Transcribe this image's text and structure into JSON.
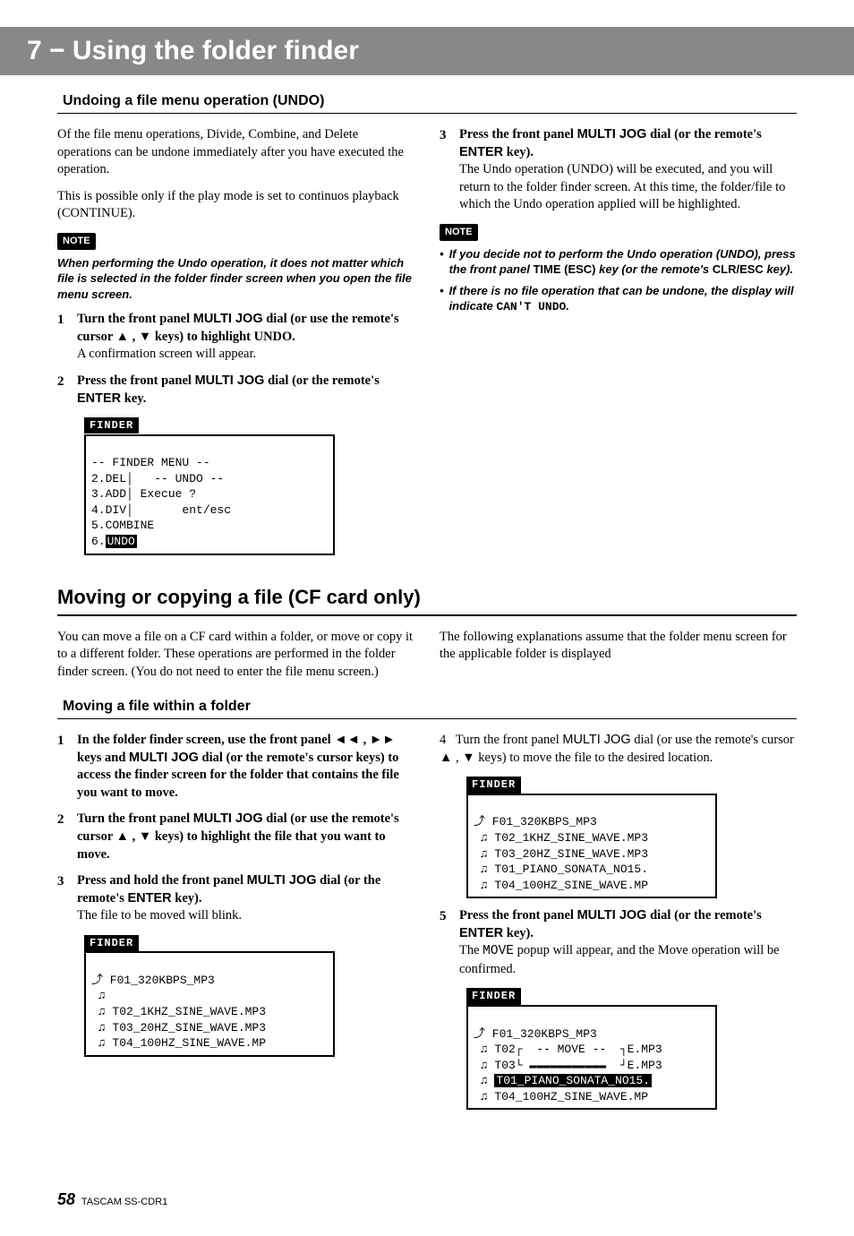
{
  "header": {
    "title": "7 − Using the folder finder"
  },
  "undo_section": {
    "heading": "Undoing a file menu operation (UNDO)",
    "intro1": "Of the file menu operations, Divide, Combine, and Delete operations can be undone immediately after you have executed the operation.",
    "intro2": "This is possible only if the play mode is set to continuos playback (CONTINUE).",
    "note_badge": "NOTE",
    "note_text": "When performing the Undo operation, it does not matter which file is selected in the folder finder screen when you open the file menu screen.",
    "step1_num": "1",
    "step1_bold_a": "Turn the front panel ",
    "step1_multi": "MULTI JOG",
    "step1_bold_b": " dial (or use the remote's cursor ▲ , ▼ keys) to highlight UNDO.",
    "step1_plain": "A confirmation screen will appear.",
    "step2_num": "2",
    "step2_bold_a": "Press the front panel ",
    "step2_multi": "MULTI JOG",
    "step2_bold_b": " dial (or the remote's ",
    "step2_enter": "ENTER",
    "step2_bold_c": " key.",
    "step3_num": "3",
    "step3_bold_a": "Press the front panel ",
    "step3_multi": "MULTI JOG",
    "step3_bold_b": " dial (or the remote's ",
    "step3_enter": "ENTER",
    "step3_bold_c": " key).",
    "step3_plain": "The Undo operation (UNDO) will be executed, and you will return to the folder finder screen. At this time, the folder/file to which the Undo operation applied will be highlighted.",
    "note2_badge": "NOTE",
    "bullet1_a": "If you decide not to perform the Undo operation (UNDO), press the front panel ",
    "bullet1_time": "TIME (ESC)",
    "bullet1_b": " key (or the remote's ",
    "bullet1_clr": "CLR/ESC",
    "bullet1_c": " key).",
    "bullet2_a": "If there is no file operation that can be undone, the display will indicate ",
    "bullet2_mono": "CAN'T UNDO",
    "bullet2_b": ".",
    "lcd1_title": "FINDER",
    "lcd1_line1": "-- FINDER MENU --",
    "lcd1_line2": "2.DEL│   -- UNDO --",
    "lcd1_line3": "3.ADD│ Execue ?",
    "lcd1_line4": "4.DIV│       ent/esc",
    "lcd1_line5": "5.COMBINE",
    "lcd1_line6a": "6.",
    "lcd1_line6b": "UNDO"
  },
  "move_section": {
    "heading": "Moving or copying a file (CF card only)",
    "intro_left": "You can move a file on a CF card within a folder, or move or copy it to a different folder. These operations are performed in the folder finder screen. (You do not need to enter the file menu screen.)",
    "intro_right": "The following explanations assume that the folder menu screen for the applicable folder is displayed",
    "sub_heading": "Moving a file within a folder",
    "step1_num": "1",
    "step1_bold_a": "In the folder finder screen, use the front panel ◄◄ , ►► keys and ",
    "step1_multi": "MULTI JOG",
    "step1_bold_b": " dial (or the remote's cursor keys) to access the finder screen for the folder that contains the file you want to move.",
    "step2_num": "2",
    "step2_bold_a": "Turn the front panel ",
    "step2_multi": "MULTI JOG",
    "step2_bold_b": " dial (or use the remote's cursor ▲ , ▼ keys) to highlight the file that you want to move.",
    "step3_num": "3",
    "step3_bold_a": "Press and hold the front panel ",
    "step3_multi": "MULTI JOG",
    "step3_bold_b": " dial (or the remote's ",
    "step3_enter": "ENTER",
    "step3_bold_c": " key).",
    "step3_plain": "The file to be moved will blink.",
    "step4_num": "4",
    "step4_bold_a": "Turn the front panel ",
    "step4_multi": "MULTI JOG",
    "step4_bold_b": " dial (or use the remote's cursor ▲ , ▼ keys) to move the file to the desired location.",
    "step5_num": "5",
    "step5_bold_a": "Press the front panel ",
    "step5_multi": "MULTI JOG",
    "step5_bold_b": " dial (or the remote's ",
    "step5_enter": "ENTER",
    "step5_bold_c": " key).",
    "step5_plain_a": "The ",
    "step5_mono": "MOVE",
    "step5_plain_b": " popup will appear, and the Move operation will be confirmed.",
    "lcd2_title": "FINDER",
    "lcd2_line1": "⤴ F01_320KBPS_MP3",
    "lcd2_line2": " ♫",
    "lcd2_line3": " ♫ T02_1KHZ_SINE_WAVE.MP3",
    "lcd2_line4": " ♫ T03_20HZ_SINE_WAVE.MP3",
    "lcd2_line5": " ♫ T04_100HZ_SINE_WAVE.MP",
    "lcd3_title": "FINDER",
    "lcd3_line1": "⤴ F01_320KBPS_MP3",
    "lcd3_line2": " ♫ T02_1KHZ_SINE_WAVE.MP3",
    "lcd3_line3": " ♫ T03_20HZ_SINE_WAVE.MP3",
    "lcd3_line4": " ♫ T01_PIANO_SONATA_NO15.",
    "lcd3_line5": " ♫ T04_100HZ_SINE_WAVE.MP",
    "lcd4_title": "FINDER",
    "lcd4_line1": "⤴ F01_320KBPS_MP3",
    "lcd4_line2": " ♫ T02┌  -- MOVE --  ┐E.MP3",
    "lcd4_line3": " ♫ T03└ ▬▬▬▬▬▬▬▬▬▬▬  ┘E.MP3",
    "lcd4_line4a": " ♫ ",
    "lcd4_line4b": "T01_PIANO_SONATA_NO15.",
    "lcd4_line5": " ♫ T04_100HZ_SINE_WAVE.MP"
  },
  "footer": {
    "page": "58",
    "label": "TASCAM SS-CDR1"
  }
}
